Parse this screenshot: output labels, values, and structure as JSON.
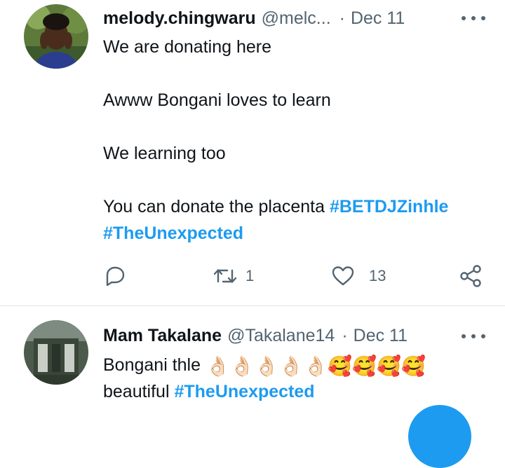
{
  "tweets": [
    {
      "display_name": "melody.chingwaru",
      "handle": "@melc...",
      "separator": "·",
      "date": "Dec 11",
      "lines": [
        "We are donating here",
        "Awww Bongani  loves to learn",
        "We learning  too",
        "You can donate the placenta"
      ],
      "hashtags": [
        "#BETDJZinhle",
        "#TheUnexpected"
      ],
      "actions": {
        "reply_icon": "reply-icon",
        "retweet_icon": "retweet-icon",
        "retweet_count": "1",
        "like_icon": "like-icon",
        "like_count": "13",
        "share_icon": "share-icon"
      }
    },
    {
      "display_name": "Mam Takalane",
      "handle": "@Takalane14",
      "separator": "·",
      "date": "Dec 11",
      "line1": "Bongani thle",
      "emojis": [
        "👌🏻",
        "👌🏻",
        "👌🏻",
        "👌🏻",
        "👌🏻",
        "🥰",
        "🥰",
        "🥰",
        "🥰"
      ],
      "line2": "beautiful",
      "hashtag": "#TheUnexpected"
    }
  ],
  "colors": {
    "link": "#1d9bf0",
    "secondary_text": "#536471",
    "divider": "#dfe3e6"
  }
}
